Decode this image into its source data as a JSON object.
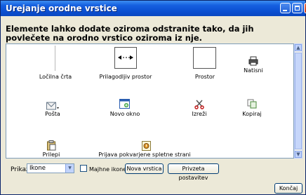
{
  "window": {
    "title": "Urejanje orodne vrstice"
  },
  "instructions": "Elemente lahko dodate oziroma odstranite tako, da jih povlečete na orodno vrstico oziroma iz nje.",
  "items": [
    {
      "label": "Ločilna črta",
      "icon": "separator-line"
    },
    {
      "label": "Prilagodljiv prostor",
      "icon": "flexible-space-icon"
    },
    {
      "label": "Prostor",
      "icon": "space-box"
    },
    {
      "label": "Natisni",
      "icon": "printer-icon"
    },
    {
      "label": "Pošta",
      "icon": "mail-icon"
    },
    {
      "label": "Novo okno",
      "icon": "new-window-icon"
    },
    {
      "label": "Izreži",
      "icon": "scissors-icon"
    },
    {
      "label": "Kopiraj",
      "icon": "copy-icon"
    },
    {
      "label": "Prilepi",
      "icon": "paste-icon"
    },
    {
      "label": "Prijava pokvarjene spletne strani",
      "icon": "broken-page-report-icon"
    }
  ],
  "controls": {
    "show_label": "Prikaži:",
    "show_value": "Ikone",
    "small_icons_label": "Majhne ikone",
    "small_icons_checked": false,
    "new_toolbar_button": "Nova vrstica",
    "reset_button": "Privzeta postavitev",
    "close_button": "Končaj"
  }
}
